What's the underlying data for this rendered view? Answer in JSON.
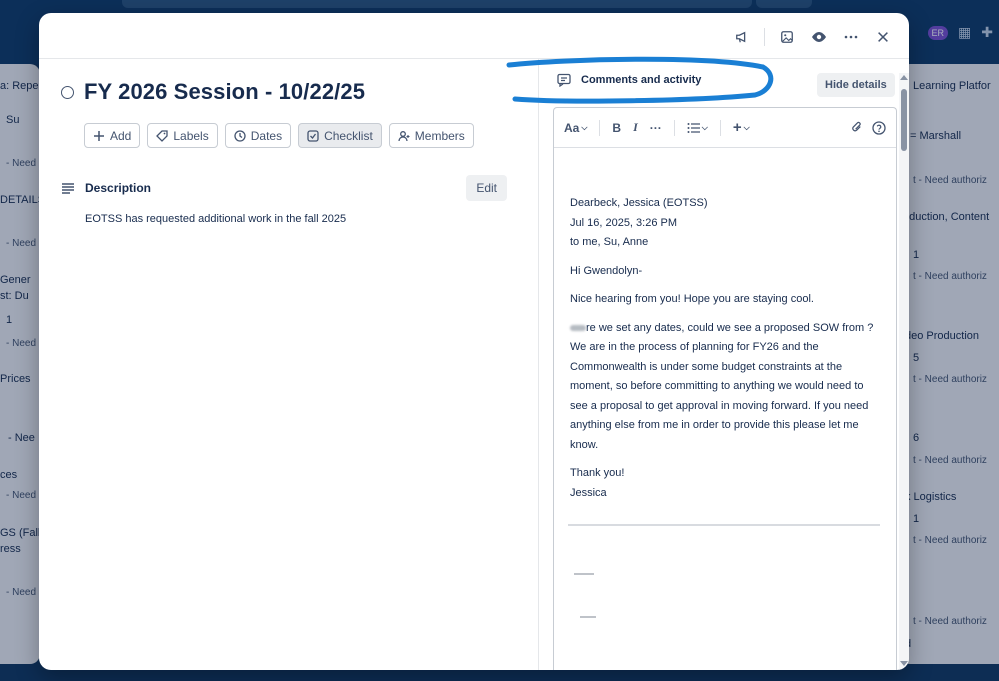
{
  "background": {
    "left_list_texts": [
      "a: Repe",
      "Su",
      "- Need a",
      "DETAILS",
      "- Need a",
      "Gener",
      "st: Du",
      "1",
      "- Need a",
      "Prices",
      "- Nee",
      "ces",
      "- Need a",
      "GS (Fall",
      "ress",
      "- Need a"
    ],
    "right_list_texts": [
      "Learning Platfor",
      "= Marshall",
      "t - Need authoriz",
      "oduction, Content",
      "1",
      "t - Need authoriz",
      "deo Production",
      "5",
      "t - Need authoriz",
      "6",
      "t - Need authoriz",
      "k Logistics",
      "1",
      "t - Need authoriz",
      "t - Need authoriz",
      "d"
    ],
    "top_badge": "ER"
  },
  "card": {
    "title": "FY 2026 Session - 10/22/25",
    "actions": [
      {
        "label": "Add",
        "icon": "plus-icon"
      },
      {
        "label": "Labels",
        "icon": "tag-icon"
      },
      {
        "label": "Dates",
        "icon": "clock-icon"
      },
      {
        "label": "Checklist",
        "icon": "checklist-icon"
      },
      {
        "label": "Members",
        "icon": "person-icon"
      }
    ],
    "description_label": "Description",
    "edit_label": "Edit",
    "description_text": "EOTSS has requested additional work in the fall 2025"
  },
  "activity": {
    "label": "Comments and activity",
    "hide_details": "Hide details",
    "toolbar": {
      "text_style": "Aa",
      "bold": "B",
      "italic": "I",
      "more": "···",
      "list": "",
      "insert": "+"
    },
    "email": {
      "from": "Dearbeck, Jessica (EOTSS)",
      "date": "Jul 16, 2025, 3:26 PM",
      "to": "to me, Su, Anne",
      "greeting": "Hi Gwendolyn-",
      "para1": "Nice hearing from you! Hope you are staying cool.",
      "para2": "re we set any dates, could we see a proposed SOW from ? We are in the process of planning for FY26 and the Commonwealth is under some budget constraints at the moment, so before committing to anything we would need to see a proposal to get approval in moving forward. If you need anything else from me in order to provide this please let me know.",
      "closing": "Thank you!",
      "signature": "Jessica"
    }
  },
  "colors": {
    "accent_annotation": "#1a7fd4",
    "board_bg": "#10375f",
    "modal_bg": "#ffffff"
  }
}
